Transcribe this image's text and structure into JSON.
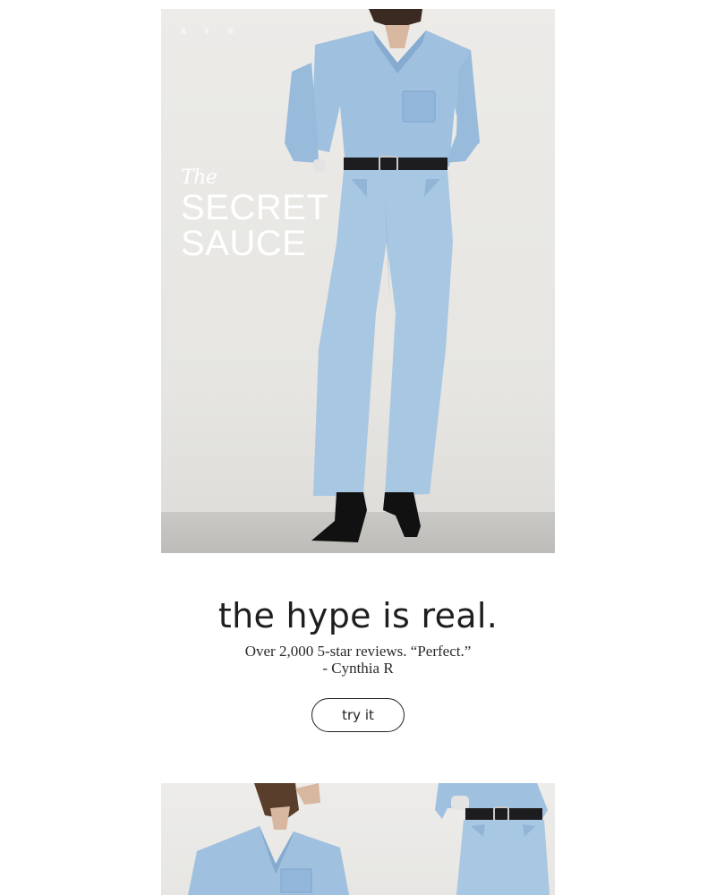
{
  "hero": {
    "brand": "A Y R",
    "headline_the": "The",
    "headline_line1": "SECRET",
    "headline_line2": "SAUCE",
    "image_alt": "model in light wash denim shirt and wide leg jeans"
  },
  "copy": {
    "tagline": "the hype is real.",
    "review_line1": "Over 2,000 5-star reviews. “Perfect.”",
    "review_line2": "- Cynthia R",
    "cta_label": "try it"
  },
  "tiles": {
    "left_alt": "model touching hair in denim shirt",
    "right_alt": "model in denim shirt and jeans with belt"
  },
  "colors": {
    "denim": "#a9c6e0",
    "denim_dark": "#8fb2d3",
    "background": "#ebeae7",
    "text": "#1e1e1e"
  }
}
